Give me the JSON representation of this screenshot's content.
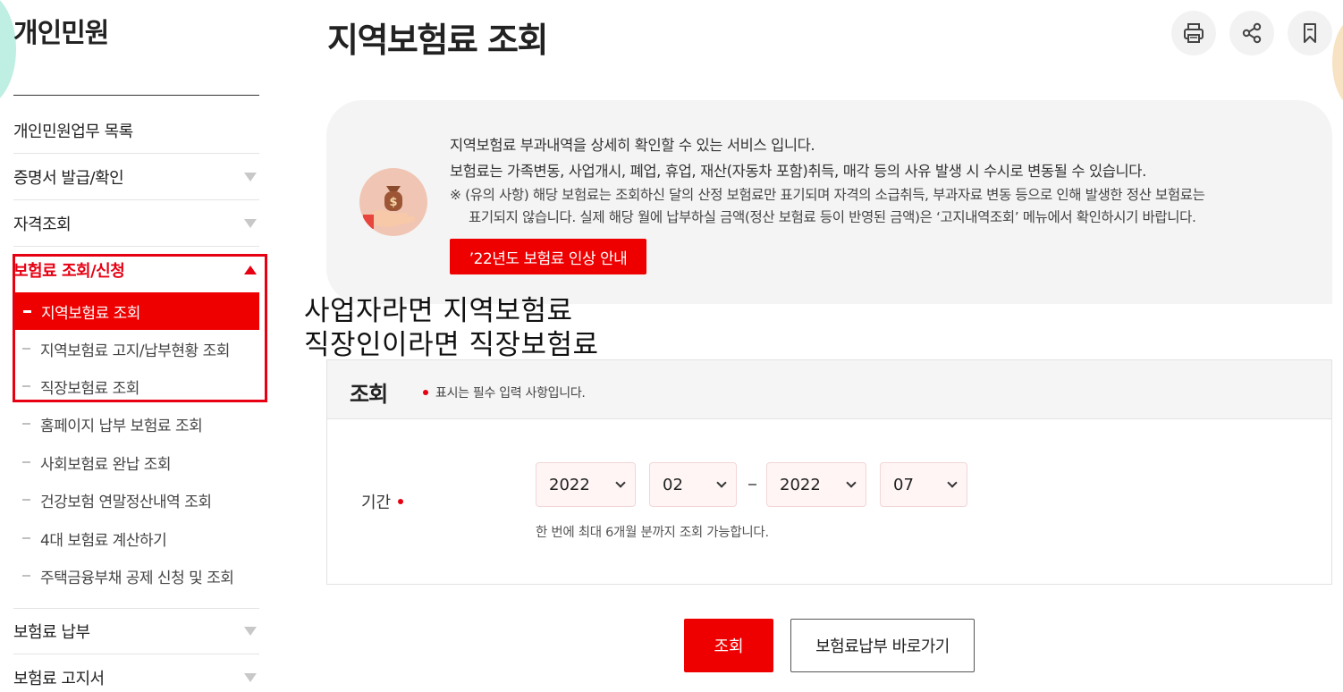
{
  "sidebar": {
    "title": "개인민원",
    "items": [
      {
        "label": "개인민원업무 목록"
      },
      {
        "label": "증명서 발급/확인"
      },
      {
        "label": "자격조회"
      },
      {
        "label": "보험료 조회/신청"
      },
      {
        "label": "보험료 납부"
      },
      {
        "label": "보험료 고지서"
      }
    ],
    "sub_items": [
      {
        "label": "지역보험료 조회"
      },
      {
        "label": "지역보험료 고지/납부현황 조회"
      },
      {
        "label": "직장보험료 조회"
      },
      {
        "label": "홈페이지 납부 보험료 조회"
      },
      {
        "label": "사회보험료 완납 조회"
      },
      {
        "label": "건강보험 연말정산내역 조회"
      },
      {
        "label": "4대 보험료 계산하기"
      },
      {
        "label": "주택금융부채 공제 신청 및 조회"
      }
    ]
  },
  "header": {
    "title": "지역보험료 조회"
  },
  "info": {
    "line1": "지역보험료 부과내역을 상세히 확인할 수 있는 서비스 입니다.",
    "line2": "보험료는 가족변동, 사업개시, 폐업, 휴업, 재산(자동차 포함)취득, 매각 등의 사유 발생 시 수시로 변동될 수 있습니다.",
    "note1": "※ (유의 사항) 해당 보험료는 조회하신 달의 산정 보험료만 표기되며 자격의 소급취득, 부과자료 변동 등으로 인해 발생한 정산 보험료는",
    "note2": "표기되지 않습니다. 실제 해당 월에 납부하실 금액(정산 보험료 등이 반영된 금액)은 ‘고지내역조회’ 메뉴에서 확인하시기 바랍니다.",
    "notice_button": "’22년도 보험료 인상 안내"
  },
  "annotation": {
    "line1": "사업자라면 지역보험료",
    "line2": "직장인이라면 직장보험료"
  },
  "search": {
    "title": "조회",
    "required_note": "표시는 필수 입력 사항입니다.",
    "period_label": "기간",
    "from_year": "2022",
    "from_month": "02",
    "to_year": "2022",
    "to_month": "07",
    "help": "한 번에 최대 6개월 분까지 조회 가능합니다."
  },
  "buttons": {
    "search": "조회",
    "payment_shortcut": "보험료납부 바로가기"
  },
  "colors": {
    "accent": "#ee0000",
    "info_bg": "#f4f4f4",
    "select_bg": "#fff5f5"
  }
}
